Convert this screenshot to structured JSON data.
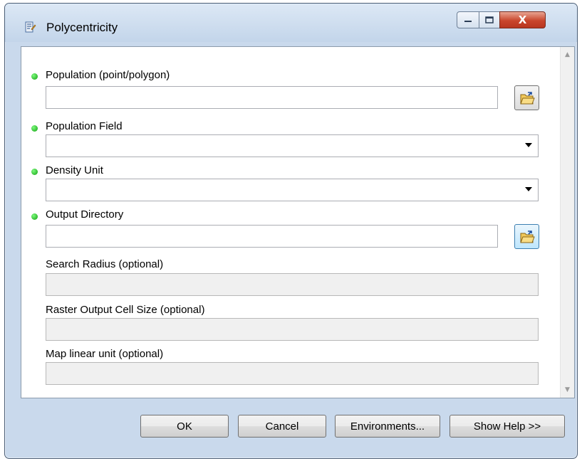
{
  "window": {
    "title": "Polycentricity",
    "close_glyph": "X"
  },
  "fields": {
    "population": {
      "label": "Population (point/polygon)",
      "value": ""
    },
    "population_field": {
      "label": "Population Field",
      "value": ""
    },
    "density_unit": {
      "label": "Density Unit",
      "value": ""
    },
    "output_directory": {
      "label": "Output Directory",
      "value": ""
    },
    "search_radius": {
      "label": "Search Radius (optional)",
      "value": ""
    },
    "raster_cell_size": {
      "label": "Raster Output Cell Size (optional)",
      "value": ""
    },
    "map_linear_unit": {
      "label": "Map linear unit (optional)",
      "value": ""
    }
  },
  "buttons": {
    "ok": "OK",
    "cancel": "Cancel",
    "environments": "Environments...",
    "show_help": "Show Help >>"
  },
  "icons": {
    "title": "script-tool-icon",
    "required": "green-dot-icon",
    "browse": "folder-open-icon"
  },
  "colors": {
    "required_dot": "#22b622",
    "close_button": "#c9452c",
    "frame": "#c9d9ec"
  }
}
